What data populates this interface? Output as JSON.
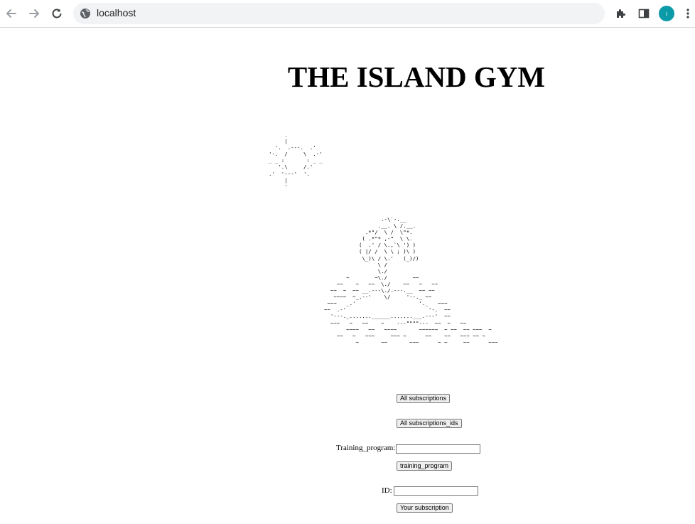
{
  "browser": {
    "url": "localhost",
    "accent_color": "#0b9aa8",
    "icons": {
      "back": "arrow-left",
      "forward": "arrow-right",
      "reload": "reload",
      "site": "globe",
      "extensions": "puzzle-piece",
      "side_panel": "side-panel",
      "profile": "avatar",
      "menu": "kebab-menu"
    }
  },
  "page": {
    "title": "THE ISLAND GYM",
    "sun_art": "     .\n     |\n  '.  .---.  .'\n'-.  /     \\  .-'\n_ _ :       : _ _\n   '.\\     /.'\n.'  '---'  '.\n     |\n     '",
    "island_art": "                  .-\\`-.__\n                 .__. \\ /.__.\n             .*\"/  \\ /  \\\"*.\n            ( .*\"* ,-\"  \\ \\.\n           (  .' / \\.,`\\ ') )\n           ( |/ /  \\ \\ ; )\\ )\n            \\_)\\ / \\.'   (_)/)\n                 \\ /\n                 \\./\n       ~        ~\\./        ~~\n    ~~    ~   ~~  \\./    ~~   ~   ~~\n  ~~  ~  ~~ __.---\\./.---.__  ~~ ~~\n   ~~~~  ~_.--'    \\/     '--._ ~~\n ~~~   _.'                    '._   ~~~\n~~  .-'                          '-.  ~~\n  '---._.......______.......___.---'  ~~\n  ~~~   ~   ~~    ~    ---\"\"\"\"---  ~~  ~   ~~\n       ~~~~   ~~   ~~~~       ~~~~~~  ~ ~~  ~~ ~~~  ~\n    ~~   ~   ~~~     ~~~ ~      ~~    ~~   ~~~ ~~ ~\n          ~       ~~       ~~~      ~ ~     ~~      ~~~",
    "buttons": {
      "all_subscriptions": "All subscriptions",
      "all_subscriptions_ids": "All subscriptions_ids",
      "training_program": "training_program",
      "your_subscription": "Your subscription"
    },
    "fields": {
      "training_program_label": "Training_program:",
      "training_program_value": "",
      "id_label": "ID:",
      "id_value": ""
    }
  }
}
